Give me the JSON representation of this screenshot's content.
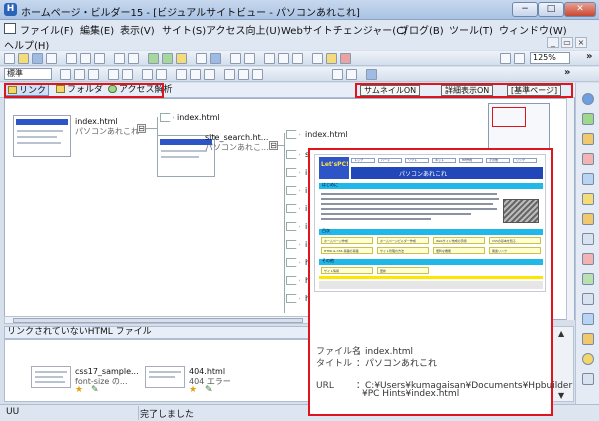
{
  "window": {
    "title": "ホームページ・ビルダー15 - [ビジュアルサイトビュー - パソコンあれこれ]",
    "min_icon": "minimize-icon",
    "max_icon": "maximize-icon",
    "close_icon": "close-icon",
    "min_glyph": "−",
    "max_glyph": "□",
    "close_glyph": "✕"
  },
  "menu": {
    "items": [
      "ファイル(F)",
      "編集(E)",
      "表示(V)",
      "サイト(S)",
      "アクセス向上(U)",
      "Webサイトチェンジャー(C)",
      "ブログ(B)",
      "ツール(T)",
      "ウィンドウ(W)"
    ],
    "help": "ヘルプ(H)",
    "mdi_min": "_",
    "mdi_restore": "▭",
    "mdi_close": "×"
  },
  "toolbar": {
    "zoom_value": "125%",
    "style_value": "標準",
    "overflow": "»"
  },
  "view_tabs": {
    "link": "リンク",
    "folder": "フォルダ",
    "access": "アクセス解析",
    "thumbnail_btn": "サムネイルON",
    "detail_btn": "詳細表示ON",
    "basepage_btn": "[基準ページ]"
  },
  "tree": {
    "root": {
      "file": "index.html",
      "title": "パソコンあれこれ"
    },
    "child": {
      "file": "site_search.ht...",
      "title": "パソコンあれこ..."
    },
    "parent_tag": "index.html",
    "leaf_first": "index.html",
    "leaves": [
      "s",
      "ir",
      "ir",
      "ir",
      "ir",
      "ir",
      "h",
      "h",
      "h"
    ],
    "collapse_glyph": "⊟"
  },
  "unlinked_panel": {
    "title": "リンクされていないHTML ファイル",
    "files": [
      {
        "name": "css17_sample...",
        "sub": "font-size の..."
      },
      {
        "name": "404.html",
        "sub": "404 エラー"
      }
    ]
  },
  "preview": {
    "site_header": "パソコンあれこれ",
    "logo": "Let'sPC!",
    "sections": [
      "はじめに",
      "目次",
      "その他"
    ],
    "nav": [
      "トップ",
      "ハード",
      "ソフト",
      "ネット",
      "HP作成",
      "その他",
      "リンク"
    ],
    "toc_cells": [
      "ホームページ作成",
      "ホームページビルダー作成",
      "Webサイト作成の手順",
      "CSSの基本を知る",
      "HTML & CSS 基礎の基礎",
      "サイト管理の方法",
      "便利な機能",
      "関連リンク"
    ],
    "other_cells": [
      "サイト情報",
      "更新"
    ],
    "file_label": "ファイル名",
    "file_value": "：index.html",
    "title_label": "タイトル",
    "title_value": "：パソコンあれこれ",
    "url_label": "URL",
    "url_value": "：C:¥Users¥kumagaisan¥Documents¥Hpbuilder",
    "url_value2": "¥PC Hints¥index.html"
  },
  "status": {
    "left": "UU",
    "message": "完了しました"
  },
  "colors": {
    "highlight": "#e0141c",
    "header_blue": "#2147b8",
    "section_cyan": "#1fb8e8"
  }
}
